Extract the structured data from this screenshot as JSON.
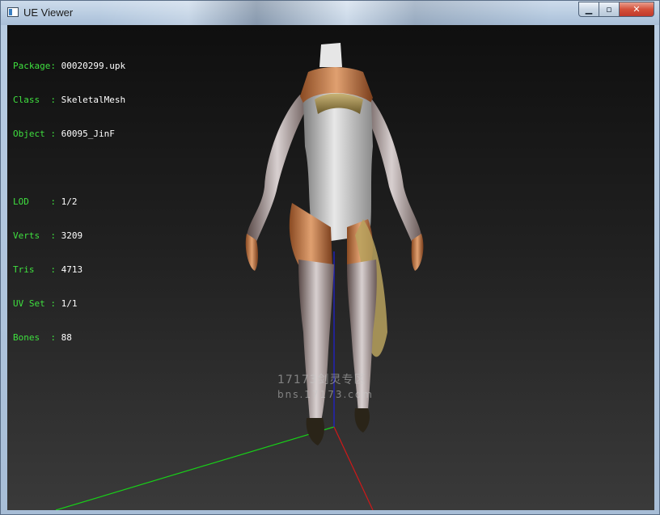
{
  "window": {
    "title": "UE Viewer",
    "icon": "app-window-icon",
    "buttons": {
      "minimize": "▁",
      "maximize": "▫",
      "close": "✕"
    }
  },
  "info": {
    "package": {
      "label": "Package:",
      "value": "00020299.upk"
    },
    "class": {
      "label": "Class  :",
      "value": "SkeletalMesh"
    },
    "object": {
      "label": "Object :",
      "value": "60095_JinF"
    },
    "lod": {
      "label": "LOD    :",
      "value": "1/2"
    },
    "verts": {
      "label": "Verts  :",
      "value": "3209"
    },
    "tris": {
      "label": "Tris   :",
      "value": "4713"
    },
    "uvset": {
      "label": "UV Set :",
      "value": "1/1"
    },
    "bones": {
      "label": "Bones  :",
      "value": "88"
    }
  },
  "watermark": {
    "line1": "17173剑灵专区",
    "line2": "bns.17173.com"
  },
  "colors": {
    "label_green": "#3fe03f",
    "value_white": "#ffffff",
    "axis_x": "#d01818",
    "axis_y": "#18d018",
    "axis_z": "#1818d0"
  }
}
